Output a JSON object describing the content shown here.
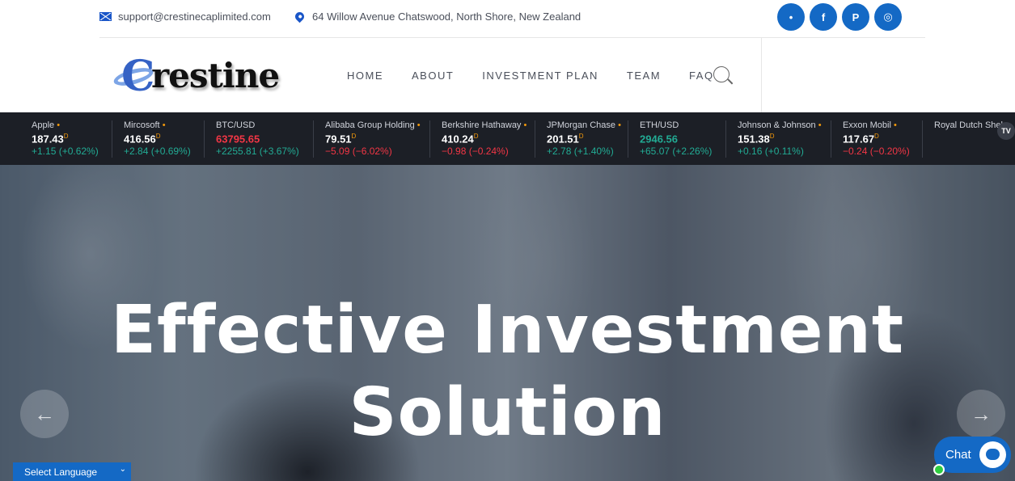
{
  "topbar": {
    "email": "support@crestinecaplimited.com",
    "address": "64 Willow Avenue Chatswood, North Shore, New Zealand",
    "social": [
      {
        "icon": "twitter-icon",
        "glyph": "•"
      },
      {
        "icon": "facebook-icon",
        "glyph": "f"
      },
      {
        "icon": "pinterest-icon",
        "glyph": "P"
      },
      {
        "icon": "instagram-icon",
        "glyph": "◎"
      }
    ]
  },
  "header": {
    "logo_text": "restine",
    "logo_letter": "C",
    "nav": [
      "HOME",
      "ABOUT",
      "INVESTMENT PLAN",
      "TEAM",
      "FAQ"
    ]
  },
  "ticker": [
    {
      "name": "Apple",
      "dot": "•",
      "price": "187.43",
      "sup": "D",
      "change": "+1.15 (+0.62%)",
      "dir": "up",
      "price_color": "white"
    },
    {
      "name": "Mircosoft",
      "dot": "•",
      "price": "416.56",
      "sup": "D",
      "change": "+2.84 (+0.69%)",
      "dir": "up",
      "price_color": "white"
    },
    {
      "name": "BTC/USD",
      "dot": "",
      "price": "63795.65",
      "sup": "",
      "change": "+2255.81 (+3.67%)",
      "dir": "up",
      "price_color": "dn"
    },
    {
      "name": "Alibaba Group Holding",
      "dot": "•",
      "price": "79.51",
      "sup": "D",
      "change": "−5.09 (−6.02%)",
      "dir": "dn",
      "price_color": "white"
    },
    {
      "name": "Berkshire Hathaway",
      "dot": "•",
      "price": "410.24",
      "sup": "D",
      "change": "−0.98 (−0.24%)",
      "dir": "dn",
      "price_color": "white"
    },
    {
      "name": "JPMorgan Chase",
      "dot": "•",
      "price": "201.51",
      "sup": "D",
      "change": "+2.78 (+1.40%)",
      "dir": "up",
      "price_color": "white"
    },
    {
      "name": "ETH/USD",
      "dot": "",
      "price": "2946.56",
      "sup": "",
      "change": "+65.07 (+2.26%)",
      "dir": "up",
      "price_color": "up"
    },
    {
      "name": "Johnson & Johnson",
      "dot": "•",
      "price": "151.38",
      "sup": "D",
      "change": "+0.16 (+0.11%)",
      "dir": "up",
      "price_color": "white"
    },
    {
      "name": "Exxon Mobil",
      "dot": "•",
      "price": "117.67",
      "sup": "D",
      "change": "−0.24 (−0.20%)",
      "dir": "dn",
      "price_color": "white"
    },
    {
      "name": "Royal Dutch Shel",
      "dot": "",
      "price": "",
      "sup": "",
      "change": "",
      "dir": "up",
      "price_color": "white"
    }
  ],
  "hero": {
    "title_line1": "Effective Investment",
    "title_line2": "Solution",
    "prev_glyph": "←",
    "next_glyph": "→"
  },
  "widgets": {
    "language": "Select Language",
    "chat": "Chat"
  },
  "colors": {
    "accent": "#1469c5",
    "ticker_bg": "#1c1f26",
    "up": "#22ab94",
    "down": "#f23645"
  }
}
